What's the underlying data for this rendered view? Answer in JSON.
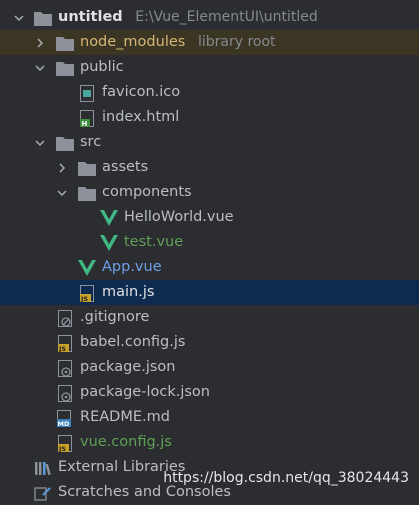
{
  "project": {
    "name": "untitled",
    "path": "E:\\Vue_ElementUI\\untitled"
  },
  "tree": {
    "node_modules": {
      "name": "node_modules",
      "hint": "library root"
    },
    "public": {
      "name": "public",
      "favicon": "favicon.ico",
      "index": "index.html"
    },
    "src": {
      "name": "src",
      "assets": "assets",
      "components": "components",
      "helloworld": "HelloWorld.vue",
      "test": "test.vue",
      "app": "App.vue",
      "main": "main.js"
    },
    "root_files": {
      "gitignore": ".gitignore",
      "babel": "babel.config.js",
      "package": "package.json",
      "package_lock": "package-lock.json",
      "readme": "README.md",
      "vue_config": "vue.config.js"
    },
    "external_libraries": "External Libraries",
    "scratches": "Scratches and Consoles"
  },
  "icon_badges": {
    "html": "H",
    "js": "JS",
    "md": "MD"
  },
  "watermark": "https://blog.csdn.net/qq_38024443",
  "colors": {
    "background": "#2b2d30",
    "selection": "#0e2b4f",
    "excluded_highlight": "#3b3523",
    "vue_green": "#41b883",
    "folder_gray": "#8e9199",
    "modified_blue": "#6f9fe8",
    "new_green": "#5f9f55",
    "excluded_yellow": "#d5b778"
  }
}
